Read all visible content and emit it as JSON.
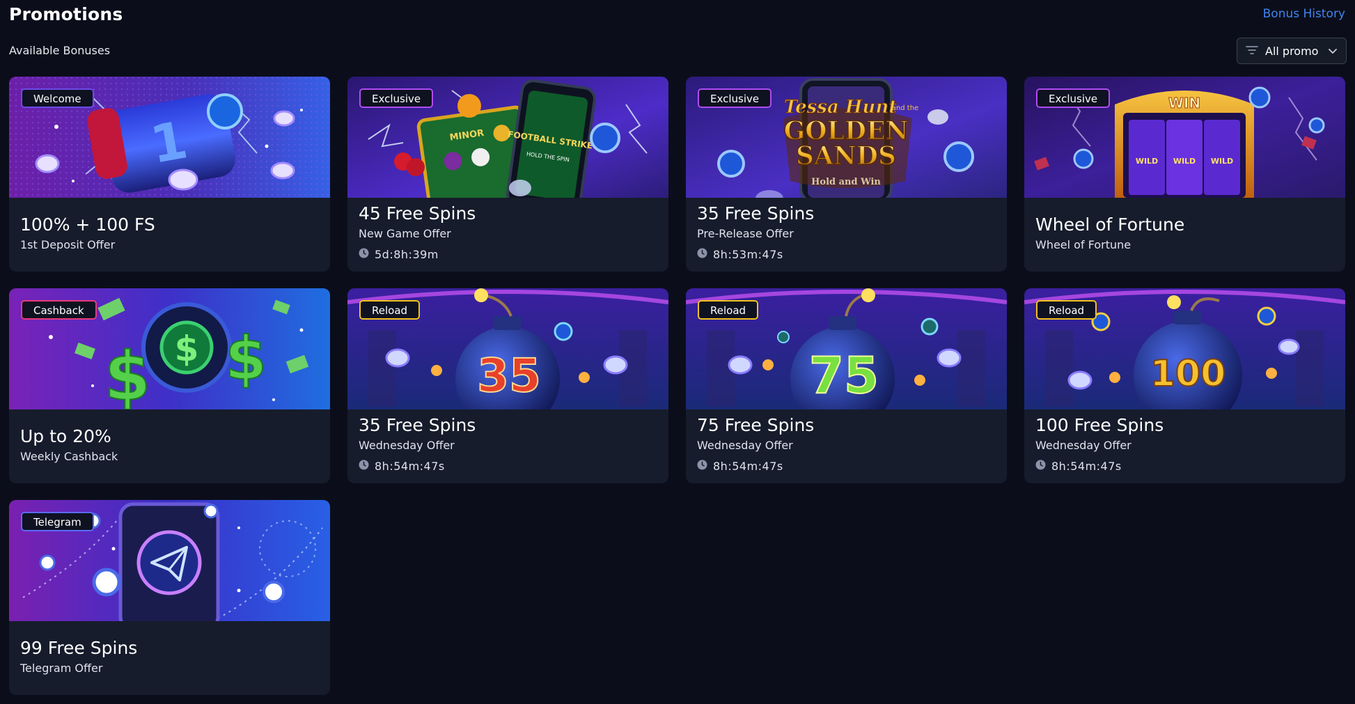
{
  "header": {
    "title": "Promotions",
    "history_link": "Bonus History",
    "section_label": "Available Bonuses",
    "filter": {
      "label": "All promo",
      "icon": "filter-lines-icon"
    }
  },
  "colors": {
    "background": "#0b0e1a",
    "card": "#161c2b",
    "link": "#3f84f0",
    "badge_welcome": "#6a4de8",
    "badge_exclusive": "#b04cf2",
    "badge_cashback": "#e83a7a",
    "badge_reload": "#f2c31d",
    "badge_telegram": "#5b6cf5"
  },
  "promotions": [
    {
      "badge": "Welcome",
      "title": "100% + 100 FS",
      "subtitle": "1st Deposit Offer",
      "timer": ""
    },
    {
      "badge": "Exclusive",
      "title": "45 Free Spins",
      "subtitle": "New Game Offer",
      "timer": "5d:8h:39m"
    },
    {
      "badge": "Exclusive",
      "title": "35 Free Spins",
      "subtitle": "Pre-Release Offer",
      "timer": "8h:53m:47s",
      "banner_text": [
        "Tessa Hunt",
        "and the",
        "GOLDEN",
        "SANDS",
        "Hold and Win"
      ]
    },
    {
      "badge": "Exclusive",
      "title": "Wheel of Fortune",
      "subtitle": "Wheel of Fortune",
      "timer": "",
      "banner_text": [
        "WIN",
        "WILD",
        "WILD",
        "WILD"
      ]
    },
    {
      "badge": "Cashback",
      "title": "Up to 20%",
      "subtitle": "Weekly Cashback",
      "timer": ""
    },
    {
      "badge": "Reload",
      "title": "35 Free Spins",
      "subtitle": "Wednesday Offer",
      "timer": "8h:54m:47s",
      "banner_text": [
        "35"
      ]
    },
    {
      "badge": "Reload",
      "title": "75 Free Spins",
      "subtitle": "Wednesday Offer",
      "timer": "8h:54m:47s",
      "banner_text": [
        "75"
      ]
    },
    {
      "badge": "Reload",
      "title": "100 Free Spins",
      "subtitle": "Wednesday Offer",
      "timer": "8h:54m:47s",
      "banner_text": [
        "100"
      ]
    },
    {
      "badge": "Telegram",
      "title": "99 Free Spins",
      "subtitle": "Telegram Offer",
      "timer": ""
    }
  ],
  "banner_extra": {
    "game1_label": "MINOR",
    "game2_label": "FOOTBALL STRIKE",
    "game2_sub": "HOLD THE SPIN",
    "slot_digit": "1"
  }
}
